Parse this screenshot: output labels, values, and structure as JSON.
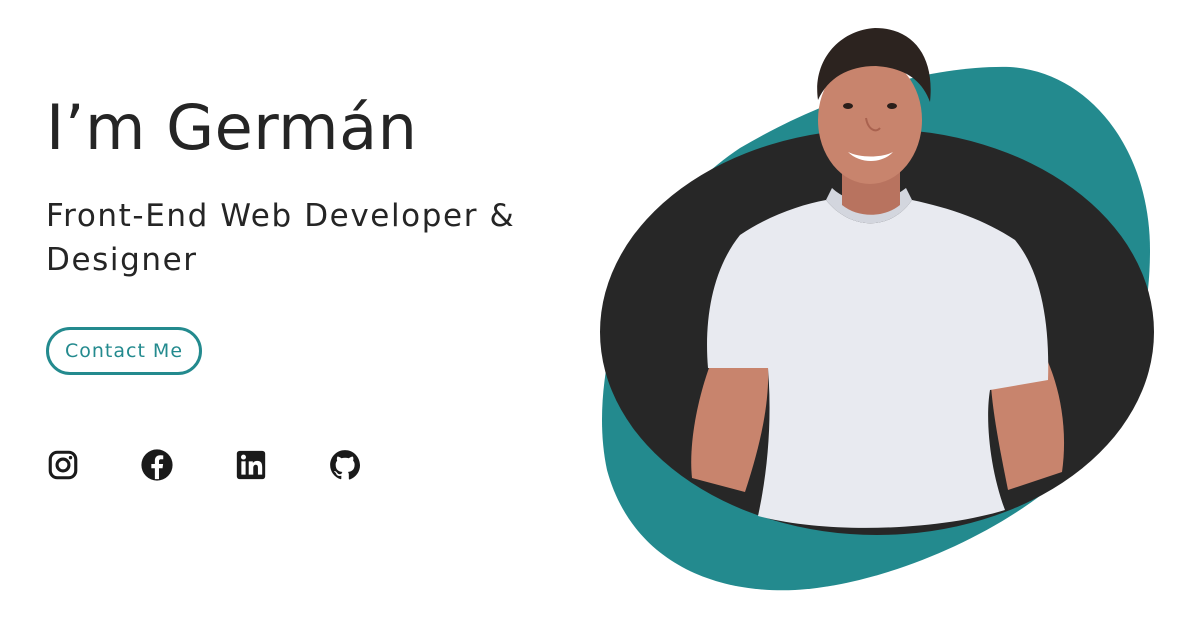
{
  "hero": {
    "title": "I’m Germán",
    "subtitle": "Front-End Web Developer & Designer",
    "cta_label": "Contact Me"
  },
  "social": {
    "items": [
      {
        "icon": "instagram-icon"
      },
      {
        "icon": "facebook-icon"
      },
      {
        "icon": "linkedin-icon"
      },
      {
        "icon": "github-icon"
      }
    ]
  },
  "colors": {
    "accent": "#238a8e",
    "dark_blob": "#272727",
    "text": "#252525",
    "skin": "#c8846d",
    "shirt": "#e8eaf0",
    "hair": "#2c231f"
  }
}
